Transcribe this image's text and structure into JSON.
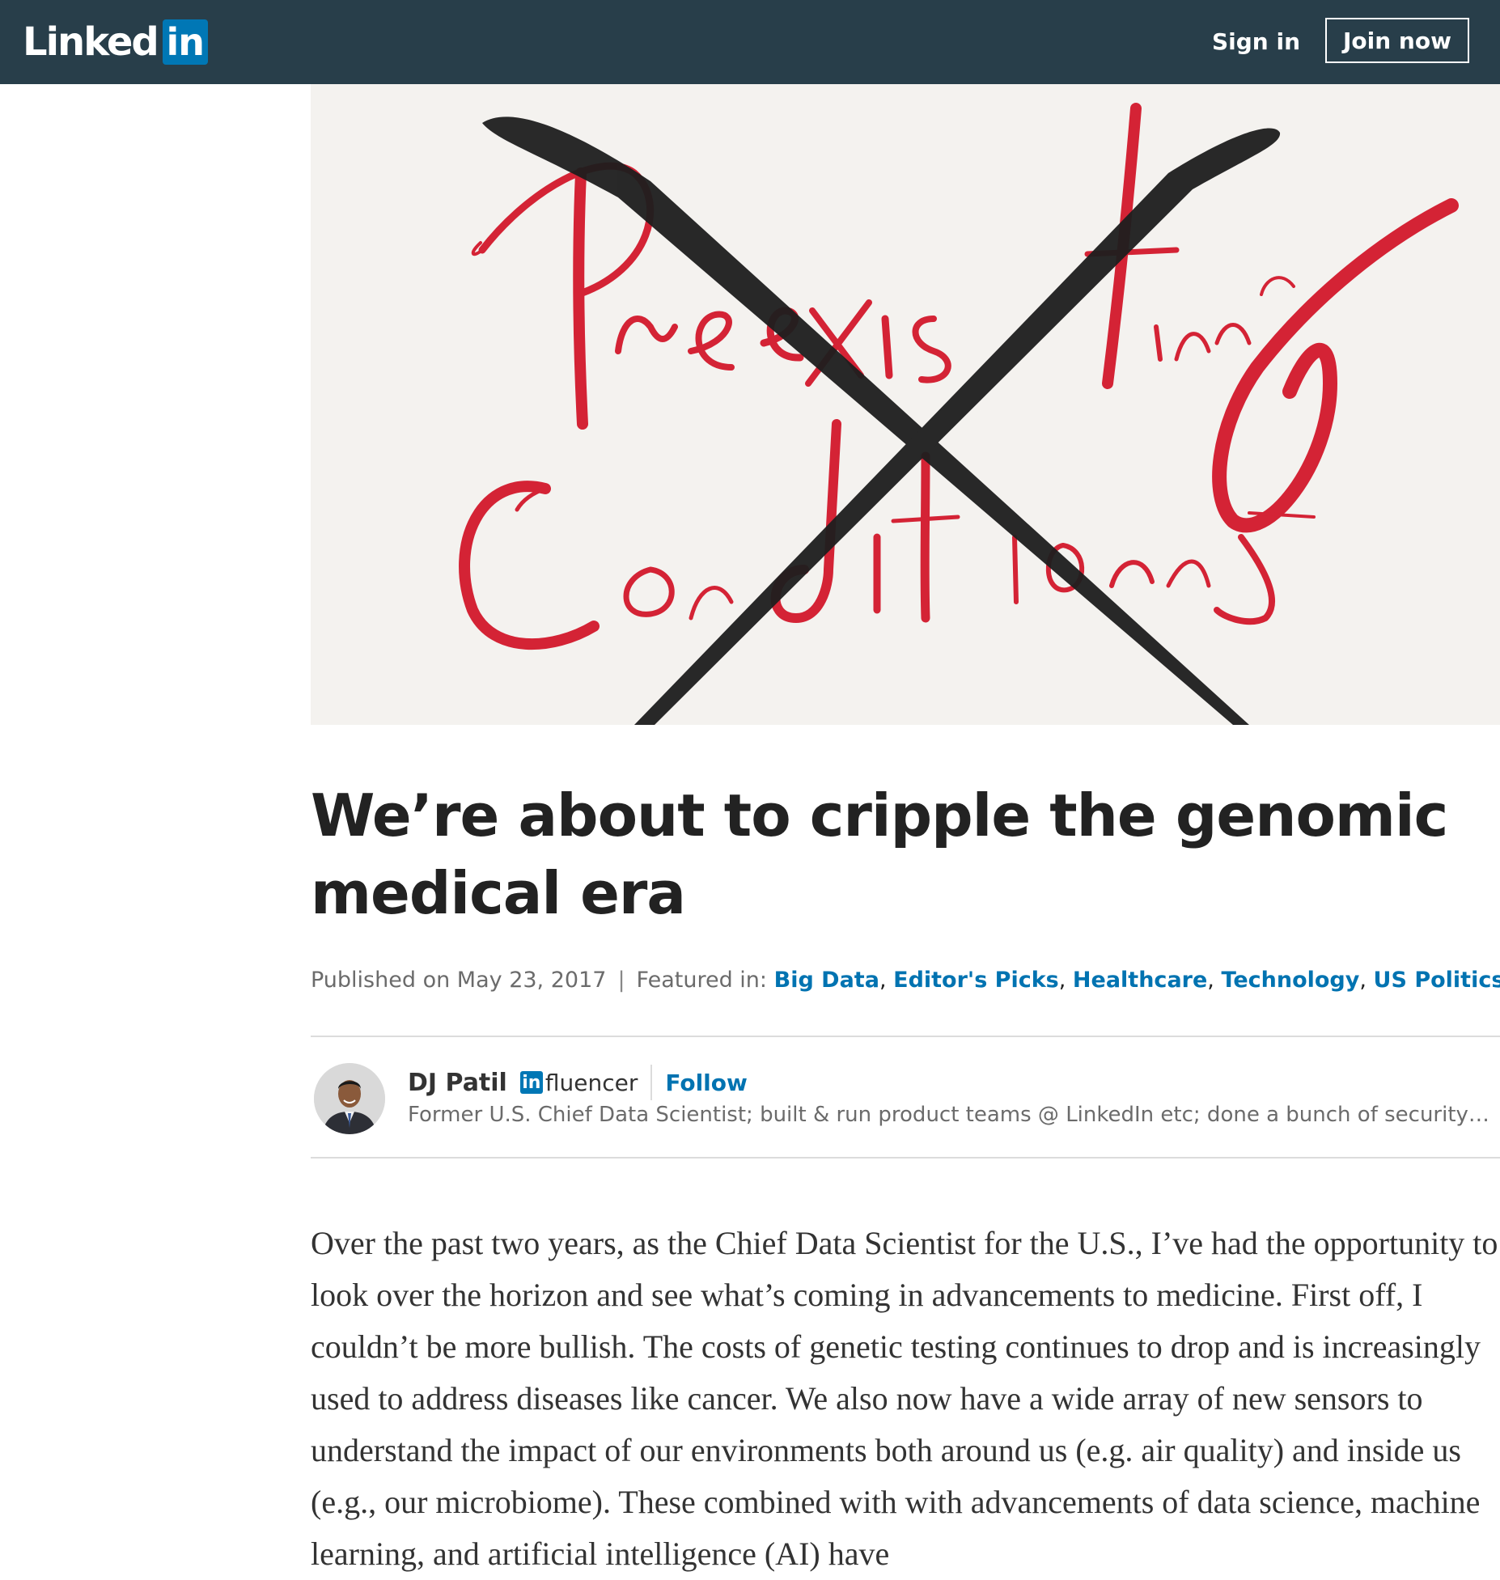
{
  "header": {
    "logo_text": "Linked",
    "logo_box": "in",
    "sign_in": "Sign in",
    "join_now": "Join now"
  },
  "hero": {
    "alt_text": "Preexisting Conditions crossed out",
    "line1": "Preexisting",
    "line2": "Conditions"
  },
  "article": {
    "title": "We’re about to cripple the genomic medical era",
    "published_label": "Published on May 23, 2017",
    "separator": "|",
    "featured_label": "Featured in:",
    "featured_tags": [
      "Big Data",
      "Editor's Picks",
      "Healthcare",
      "Technology",
      "US Politics"
    ],
    "author": {
      "name": "DJ Patil",
      "badge_in": "in",
      "badge_word": "fluencer",
      "follow": "Follow",
      "headline": "Former U.S. Chief Data Scientist; built & run product teams @ LinkedIn etc; done a bunch of security and s…"
    },
    "body": "Over the past two years, as the Chief Data Scientist for the U.S., I’ve had the opportunity to look over the horizon and see what’s coming in advancements to medicine. First off, I couldn’t be more bullish. The costs of genetic testing continues to drop and is increasingly used to address diseases like cancer. We also now have a wide array of new sensors to understand the impact of our environments both around us (e.g. air quality) and inside us (e.g., our microbiome). These combined with with advancements of data science, machine learning, and artificial intelligence (AI) have"
  },
  "colors": {
    "topbar": "#283e4a",
    "brand_blue": "#0077b5",
    "link_blue": "#0073b1",
    "hero_red": "#d42335",
    "hero_black": "#1e1e1e"
  }
}
